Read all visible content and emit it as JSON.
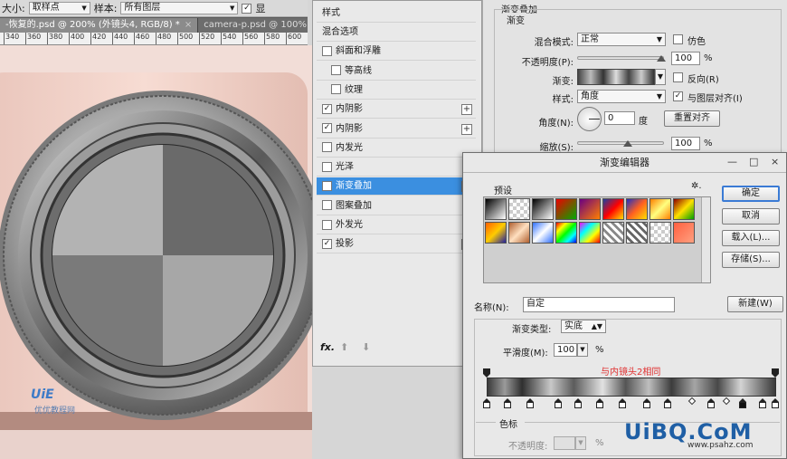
{
  "optionsbar": {
    "size_label": "大小:",
    "size_value": "取样点",
    "sample_label": "样本:",
    "sample_value": "所有图层",
    "show_label": "显"
  },
  "tabs": [
    {
      "label": "-恢复的.psd @ 200% (外镜头4, RGB/8) *",
      "close": "×"
    },
    {
      "label": "camera-p.psd @ 100% (钚·",
      "close": ""
    }
  ],
  "ruler": [
    "340",
    "360",
    "380",
    "400",
    "420",
    "440",
    "460",
    "480",
    "500",
    "520",
    "540",
    "560",
    "580",
    "600"
  ],
  "styles_panel": {
    "header": "样式",
    "items": [
      {
        "label": "混合选项",
        "check": false,
        "hasCheck": false,
        "plus": false
      },
      {
        "label": "斜面和浮雕",
        "check": false,
        "hasCheck": true,
        "plus": false
      },
      {
        "label": "等高线",
        "check": false,
        "hasCheck": true,
        "plus": false,
        "indent": true
      },
      {
        "label": "纹理",
        "check": false,
        "hasCheck": true,
        "plus": false,
        "indent": true
      },
      {
        "label": "内阴影",
        "check": true,
        "hasCheck": true,
        "plus": true
      },
      {
        "label": "内阴影",
        "check": true,
        "hasCheck": true,
        "plus": true
      },
      {
        "label": "内发光",
        "check": false,
        "hasCheck": true,
        "plus": false
      },
      {
        "label": "光泽",
        "check": false,
        "hasCheck": true,
        "plus": false
      },
      {
        "label": "渐变叠加",
        "check": true,
        "hasCheck": true,
        "plus": true,
        "selected": true
      },
      {
        "label": "图案叠加",
        "check": false,
        "hasCheck": true,
        "plus": false
      },
      {
        "label": "外发光",
        "check": false,
        "hasCheck": true,
        "plus": false
      },
      {
        "label": "投影",
        "check": true,
        "hasCheck": true,
        "plus": true
      }
    ],
    "fx": "fx.",
    "up": "⬆",
    "down": "⬇"
  },
  "gradient_overlay": {
    "group_title": "渐变叠加",
    "sub_title": "渐变",
    "blend_mode_label": "混合模式:",
    "blend_mode_value": "正常",
    "dither_label": "仿色",
    "opacity_label": "不透明度(P):",
    "opacity_value": "100",
    "opacity_unit": "%",
    "gradient_label": "渐变:",
    "reverse_label": "反向(R)",
    "style_label": "样式:",
    "style_value": "角度",
    "align_label": "与图层对齐(I)",
    "angle_label": "角度(N):",
    "angle_value": "0",
    "angle_unit": "度",
    "reset_align_label": "重置对齐",
    "scale_label": "缩放(S):",
    "scale_value": "100",
    "scale_unit": "%"
  },
  "gradient_editor": {
    "title": "渐变编辑器",
    "minimize": "—",
    "maximize": "□",
    "close": "×",
    "presets_label": "预设",
    "gear": "✲.",
    "ok_label": "确定",
    "cancel_label": "取消",
    "load_label": "载入(L)...",
    "save_label": "存储(S)...",
    "name_label": "名称(N):",
    "name_value": "自定",
    "new_label": "新建(W)",
    "type_label": "渐变类型:",
    "type_value": "实底",
    "smooth_label": "平滑度(M):",
    "smooth_value": "100",
    "smooth_unit": "%",
    "annotation": "与内镜头2相同",
    "color_stops_label": "色标",
    "stop_opacity_label": "不透明度:",
    "stop_opacity_unit": "%"
  },
  "watermark": {
    "main": "UiBQ.CoM",
    "sub": "www.psahz.com",
    "logo": "UiE",
    "logo_sub": "优优教程网"
  },
  "colors": {
    "accent": "#3b8fe0",
    "annotation": "#e03030",
    "canvas_bg": "#f3dcd6"
  }
}
